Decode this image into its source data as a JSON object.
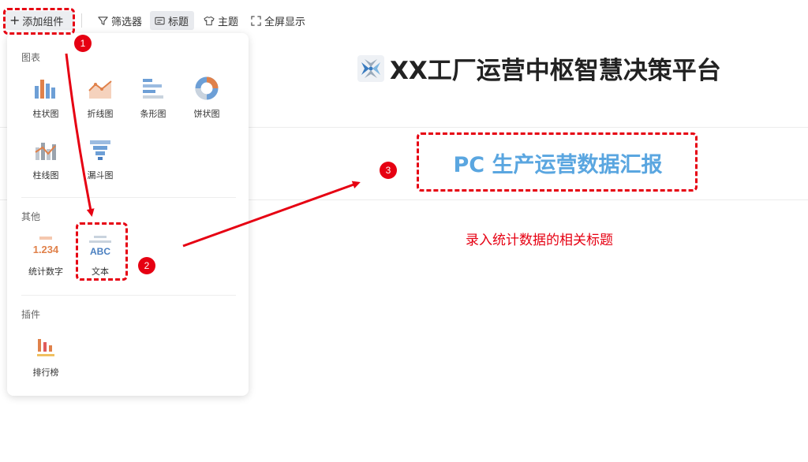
{
  "toolbar": {
    "add_component": "添加组件",
    "filter": "筛选器",
    "title": "标题",
    "theme": "主题",
    "fullscreen": "全屏显示"
  },
  "panel": {
    "sections": {
      "charts": "图表",
      "others": "其他",
      "plugins": "插件"
    },
    "chart_items": [
      "柱状图",
      "折线图",
      "条形图",
      "饼状图",
      "柱线图",
      "漏斗图"
    ],
    "other_items": [
      "统计数字",
      "文本"
    ],
    "plugin_items": [
      "排行榜"
    ],
    "stat_sample": "1.234",
    "text_sample": "ABC"
  },
  "canvas": {
    "platform_title": "XX工厂运营中枢智慧决策平台",
    "report_title": "PC 生产运营数据汇报",
    "hint": "录入统计数据的相关标题"
  },
  "annotations": {
    "step1": "1",
    "step2": "2",
    "step3": "3"
  },
  "colors": {
    "accent_red": "#e60012",
    "report_blue": "#5aa6e0",
    "icon_orange": "#e0814a",
    "icon_blue": "#6d9fd6"
  }
}
